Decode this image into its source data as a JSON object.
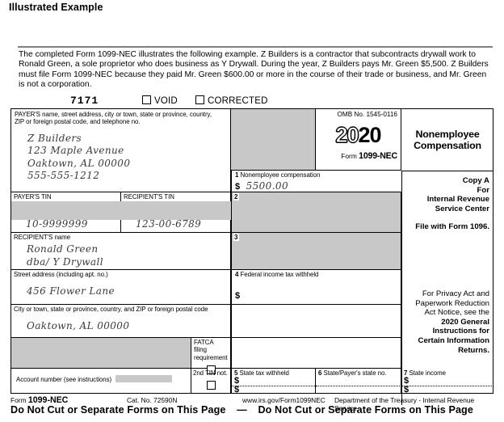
{
  "doc": {
    "title": "Illustrated Example",
    "intro": "The completed Form 1099-NEC illustrates the following example. Z Builders is a contractor that subcontracts drywall work to Ronald Green, a sole proprietor who does business as Y Drywall. During the year, Z Builders pays Mr. Green $5,500. Z Builders must file Form 1099-NEC because they paid Mr. Green $600.00 or more in the course of their trade or business, and Mr. Green is not a corporation."
  },
  "topbar": {
    "copy_number": "7171",
    "void_label": "VOID",
    "corrected_label": "CORRECTED"
  },
  "payer": {
    "caption": "PAYER'S name, street address, city or town, state or province, country, ZIP or foreign postal code, and telephone no.",
    "name": "Z Builders",
    "street": "123 Maple Avenue",
    "city_state_zip": "Oaktown, AL 00000",
    "phone": "555-555-1212"
  },
  "omb": {
    "number": "OMB No. 1545-0116",
    "year_light": "20",
    "year_bold": "20",
    "form_prefix": "Form",
    "form_name": "1099-NEC"
  },
  "title_block": {
    "line1": "Nonemployee",
    "line2": "Compensation"
  },
  "copy_block": {
    "line1": "Copy A",
    "line2": "For",
    "line3": "Internal Revenue",
    "line4": "Service Center",
    "line5": "File with Form 1096."
  },
  "privacy_block": {
    "normal": "For Privacy Act and Paperwork Reduction Act Notice, see the",
    "bold": "2020 General Instructions for Certain Information Returns."
  },
  "tins": {
    "payer_tin_label": "PAYER'S TIN",
    "payer_tin_value": "10-9999999",
    "recipient_tin_label": "RECIPIENT'S TIN",
    "recipient_tin_value": "123-00-6789"
  },
  "recipient": {
    "name_label": "RECIPIENT'S name",
    "name": "Ronald Green",
    "dba": "dba/ Y Drywall",
    "street_label": "Street address (including apt. no.)",
    "street": "456 Flower Lane",
    "city_label": "City or town, state or province, country, and ZIP or foreign postal code",
    "city": "Oaktown, AL 00000"
  },
  "boxes": {
    "box1_num": "1",
    "box1_label": "Nonemployee compensation",
    "box1_dollar": "$",
    "box1_value": "5500.00",
    "box2_num": "2",
    "box3_num": "3",
    "box4_num": "4",
    "box4_label": "Federal income tax withheld",
    "box4_dollar": "$",
    "box5_num": "5",
    "box5_label": "State tax withheld",
    "box5_dollar_1": "$",
    "box5_dollar_2": "$",
    "box6_num": "6",
    "box6_label": "State/Payer's state no.",
    "box7_num": "7",
    "box7_label": "State income",
    "box7_dollar_1": "$",
    "box7_dollar_2": "$"
  },
  "fatca": {
    "line1": "FATCA filing",
    "line2": "requirement"
  },
  "account": {
    "label": "Account number (see instructions)",
    "second_tin": "2nd TIN not."
  },
  "footer": {
    "form_prefix": "Form",
    "form_name": "1099-NEC",
    "cat_no": "Cat. No. 72590N",
    "url": "www.irs.gov/Form1099NEC",
    "dept": "Department of the Treasury - Internal Revenue Service",
    "notice_left": "Do Not Cut or Separate Forms on This Page",
    "notice_dash": "—",
    "notice_right": "Do Not Cut or Separate Forms on This Page"
  },
  "colors": {
    "shaded": "#c8c8c8",
    "rule": "#808080",
    "ink": "#3a3a3a"
  }
}
